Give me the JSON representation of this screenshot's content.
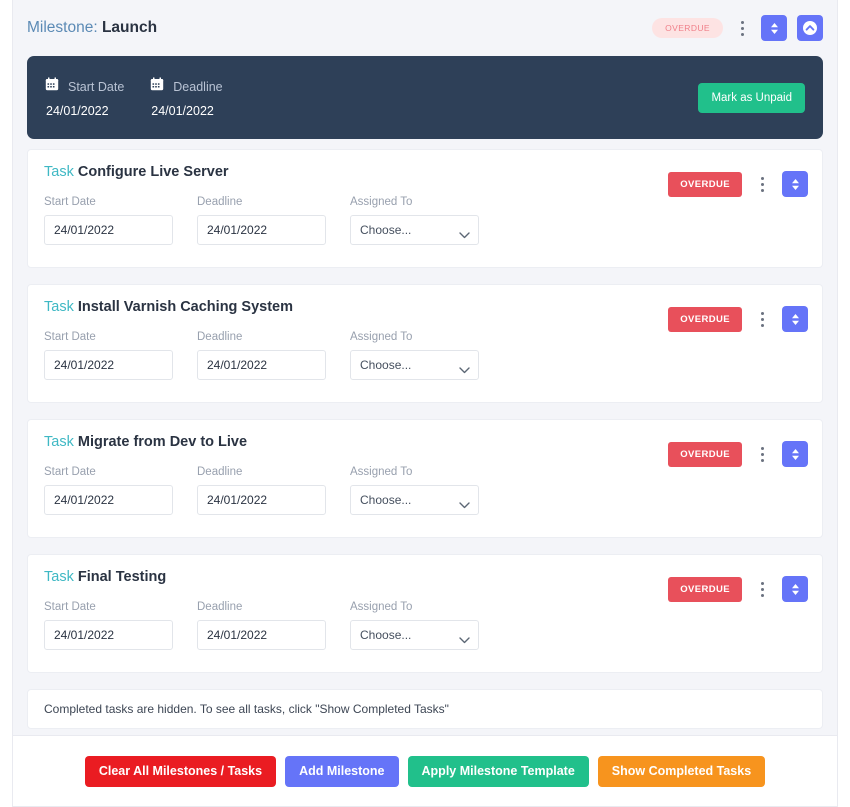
{
  "milestone": {
    "label_prefix": "Milestone:",
    "name": "Launch",
    "status_badge": "OVERDUE",
    "kebab_icon": "vertical-dots-icon",
    "reorder_icon": "sort-up-down-icon",
    "collapse_icon": "chevron-up-circle-icon",
    "info": {
      "start_label": "Start Date",
      "start_value": "24/01/2022",
      "deadline_label": "Deadline",
      "deadline_value": "24/01/2022",
      "calendar_icon": "calendar-icon",
      "payment_button": "Mark as Unpaid"
    }
  },
  "field_labels": {
    "start_date": "Start Date",
    "deadline": "Deadline",
    "assigned_to": "Assigned To"
  },
  "select_placeholder": "Choose...",
  "chevron_icon": "chevron-down-icon",
  "tasks": [
    {
      "label_prefix": "Task",
      "name": "Configure Live Server",
      "start_date": "24/01/2022",
      "deadline": "24/01/2022",
      "assigned_to": "Choose...",
      "status_badge": "OVERDUE"
    },
    {
      "label_prefix": "Task",
      "name": "Install Varnish Caching System",
      "start_date": "24/01/2022",
      "deadline": "24/01/2022",
      "assigned_to": "Choose...",
      "status_badge": "OVERDUE"
    },
    {
      "label_prefix": "Task",
      "name": "Migrate from Dev to Live",
      "start_date": "24/01/2022",
      "deadline": "24/01/2022",
      "assigned_to": "Choose...",
      "status_badge": "OVERDUE"
    },
    {
      "label_prefix": "Task",
      "name": "Final Testing",
      "start_date": "24/01/2022",
      "deadline": "24/01/2022",
      "assigned_to": "Choose...",
      "status_badge": "OVERDUE"
    }
  ],
  "hidden_tasks_note": "Completed tasks are hidden. To see all tasks, click \"Show Completed Tasks\"",
  "actions": [
    {
      "label": "Clear All Milestones / Tasks",
      "color": "#ea1c22"
    },
    {
      "label": "Add Milestone",
      "color": "#6574f8"
    },
    {
      "label": "Apply Milestone Template",
      "color": "#21c08b"
    },
    {
      "label": "Show Completed Tasks",
      "color": "#f7941e"
    }
  ],
  "colors": {
    "panel_bg": "#f4f5f9",
    "milestone_bar": "#2e4058",
    "accent_purple": "#6574f8",
    "accent_teal": "#3fb8c4",
    "overdue_solid": "#e8505b",
    "overdue_soft_bg": "#fde3e3",
    "overdue_soft_text": "#f0808a"
  }
}
